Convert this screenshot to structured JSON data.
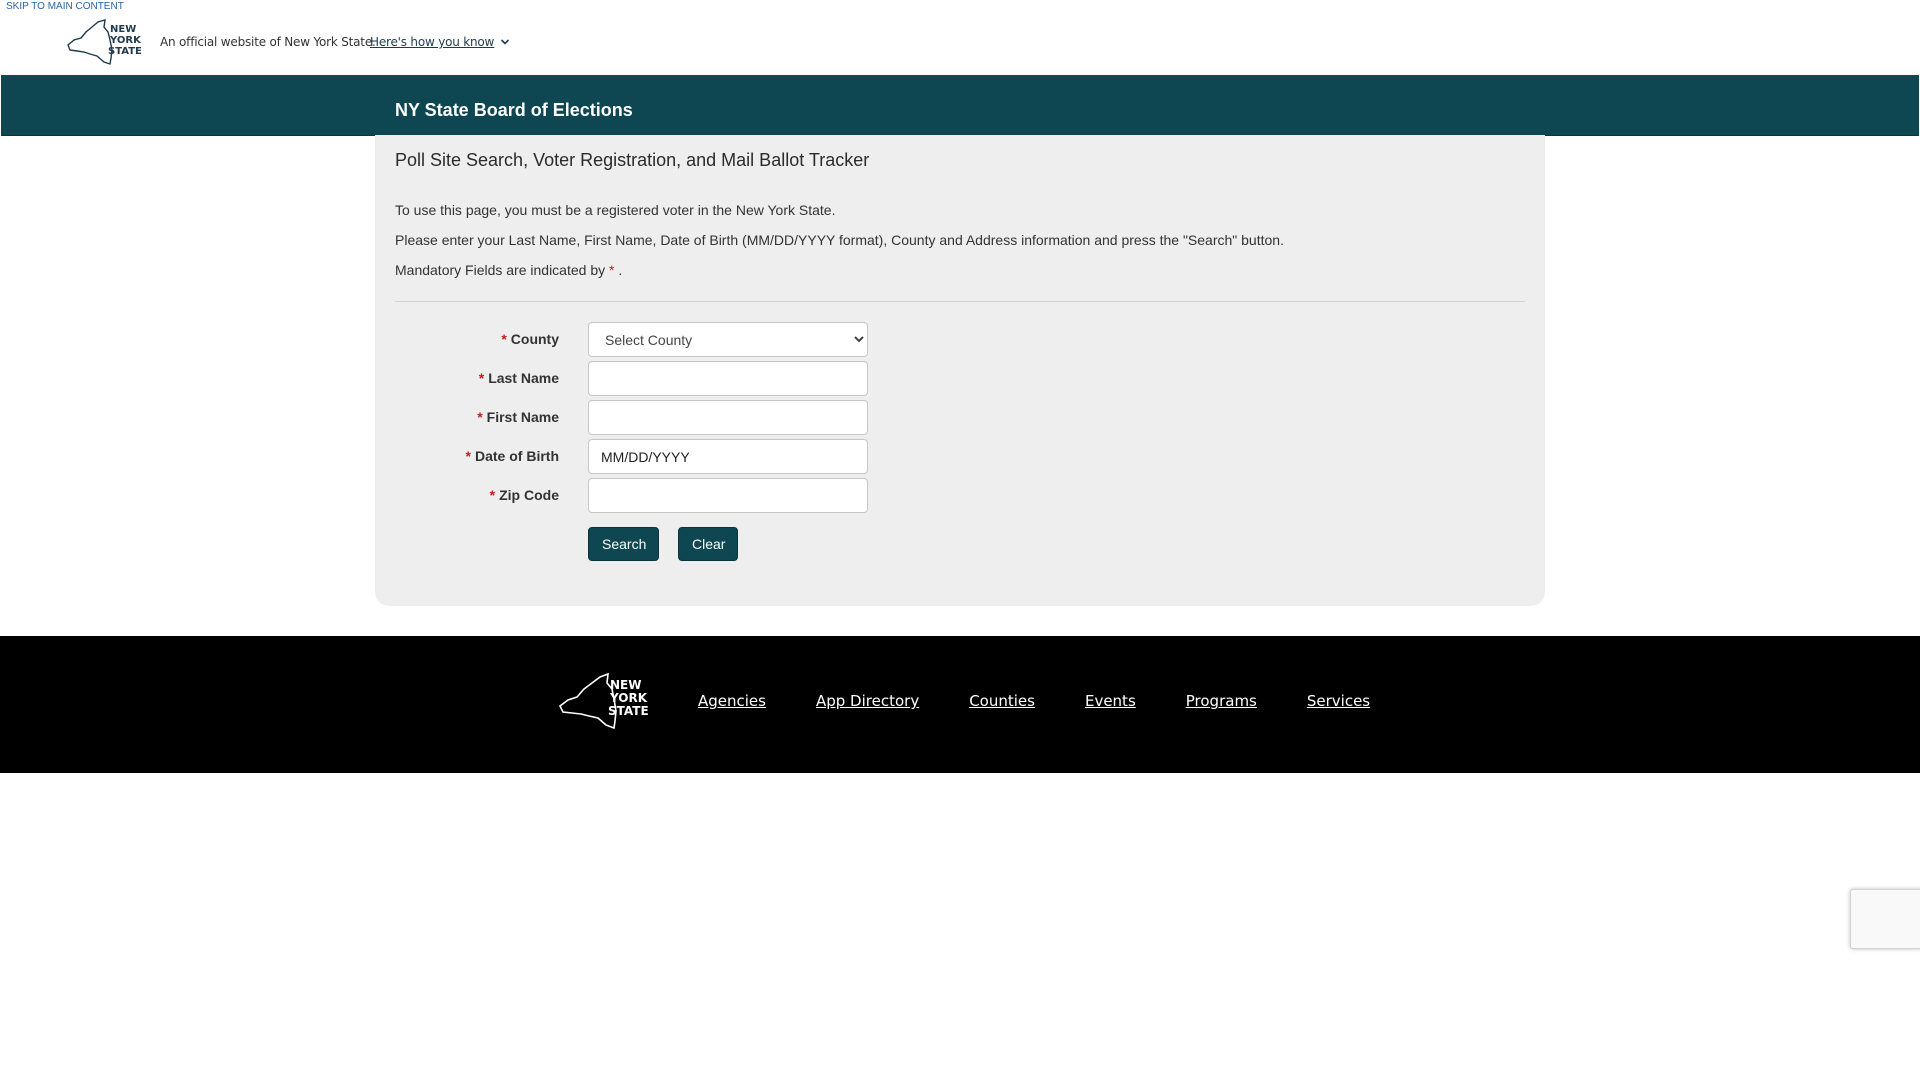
{
  "banner": {
    "skip_link": "SKIP TO MAIN CONTENT",
    "official_text": "An official website of New York State.",
    "how_you_know": "Here's how you know",
    "logo_lines": [
      "NEW",
      "YORK",
      "STATE"
    ]
  },
  "header": {
    "agency_title": "NY State Board of Elections"
  },
  "main": {
    "heading": "Poll Site Search, Voter Registration, and Mail Ballot Tracker",
    "intro_1": "To use this page, you must be a registered voter in the New York State.",
    "intro_2": "Please enter your Last Name, First Name, Date of Birth (MM/DD/YYYY format), County and Address information and press the \"Search\" button.",
    "intro_3_prefix": "Mandatory Fields are indicated by",
    "required_marker": "*",
    "intro_3_suffix": "."
  },
  "form": {
    "county": {
      "label": "County",
      "selected": "Select County"
    },
    "last_name": {
      "label": "Last Name",
      "value": ""
    },
    "first_name": {
      "label": "First Name",
      "value": ""
    },
    "dob": {
      "label": "Date of Birth",
      "value": "MM/DD/YYYY"
    },
    "zip": {
      "label": "Zip Code",
      "value": ""
    },
    "search_label": "Search",
    "clear_label": "Clear"
  },
  "footer": {
    "logo_lines": [
      "NEW",
      "YORK",
      "STATE"
    ],
    "links": [
      "Agencies",
      "App Directory",
      "Counties",
      "Events",
      "Programs",
      "Services"
    ]
  },
  "colors": {
    "agency_bar": "#0e4751",
    "panel": "#eeeeee",
    "required": "#c41c1c",
    "footer": "#000000"
  }
}
